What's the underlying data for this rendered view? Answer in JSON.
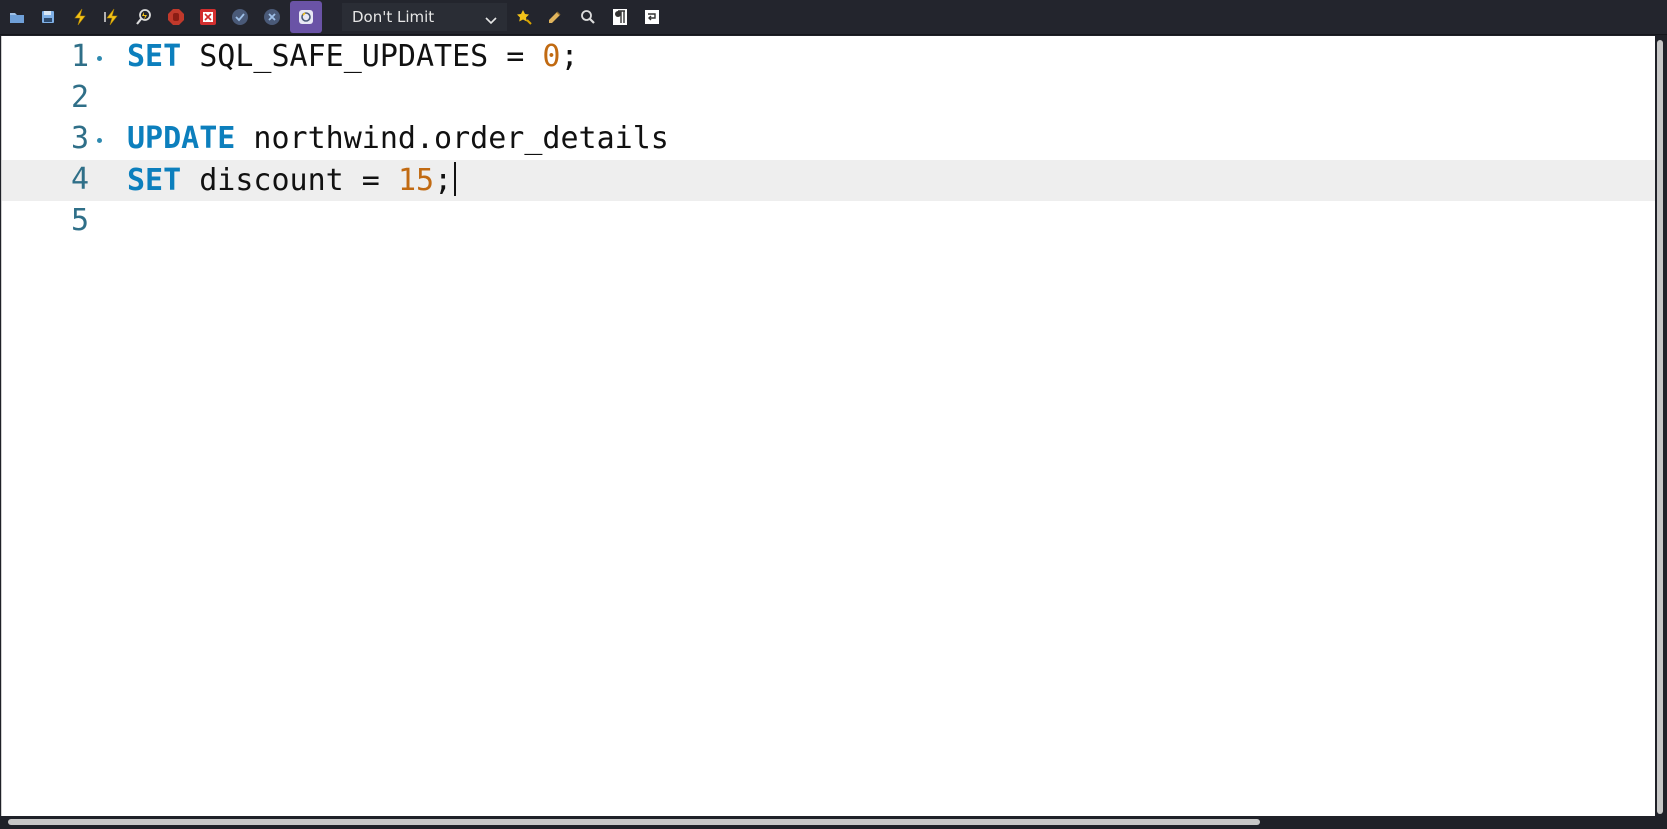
{
  "toolbar": {
    "buttons": [
      {
        "name": "open-file-icon"
      },
      {
        "name": "save-icon"
      },
      {
        "name": "execute-icon"
      },
      {
        "name": "execute-current-icon"
      },
      {
        "name": "explain-icon"
      },
      {
        "name": "stop-icon"
      },
      {
        "name": "toggle-error-continue-icon"
      },
      {
        "name": "commit-icon"
      },
      {
        "name": "rollback-icon"
      },
      {
        "name": "autocommit-icon"
      }
    ],
    "limit_value": "Don't Limit",
    "after_buttons": [
      {
        "name": "beautify-icon"
      },
      {
        "name": "format-icon"
      },
      {
        "name": "find-icon"
      },
      {
        "name": "invisible-chars-icon"
      },
      {
        "name": "wrap-lines-icon"
      }
    ]
  },
  "editor": {
    "lines": [
      {
        "number": "1",
        "tokens": [
          {
            "t": "SET",
            "c": "kw"
          },
          {
            "t": " SQL_SAFE_UPDATES = "
          },
          {
            "t": "0",
            "c": "num"
          },
          {
            "t": ";"
          }
        ]
      },
      {
        "number": "2",
        "tokens": []
      },
      {
        "number": "3",
        "tokens": [
          {
            "t": "UPDATE",
            "c": "kw"
          },
          {
            "t": " northwind.order_details"
          }
        ]
      },
      {
        "number": "4",
        "tokens": [
          {
            "t": "SET",
            "c": "kw"
          },
          {
            "t": " discount = "
          },
          {
            "t": "15",
            "c": "num"
          },
          {
            "t": ";"
          }
        ]
      },
      {
        "number": "5",
        "tokens": []
      }
    ],
    "line1_number": "1",
    "line2_number": "2",
    "line3_number": "3",
    "line4_number": "4",
    "line5_number": "5",
    "line1": {
      "kw": "SET",
      "t1": " SQL_SAFE_UPDATES = ",
      "num": "0",
      "t2": ";"
    },
    "line3": {
      "kw": "UPDATE",
      "t1": " northwind.order_details"
    },
    "line4": {
      "kw": "SET",
      "t1": " discount = ",
      "num": "15",
      "t2": ";"
    }
  },
  "colors": {
    "keyword": "#0c7fbd",
    "number": "#c16a12",
    "line_number": "#2f6f88",
    "current_line": "#eeeeee",
    "toolbar_bg": "#23252d",
    "active_button": "#6a53a6"
  }
}
